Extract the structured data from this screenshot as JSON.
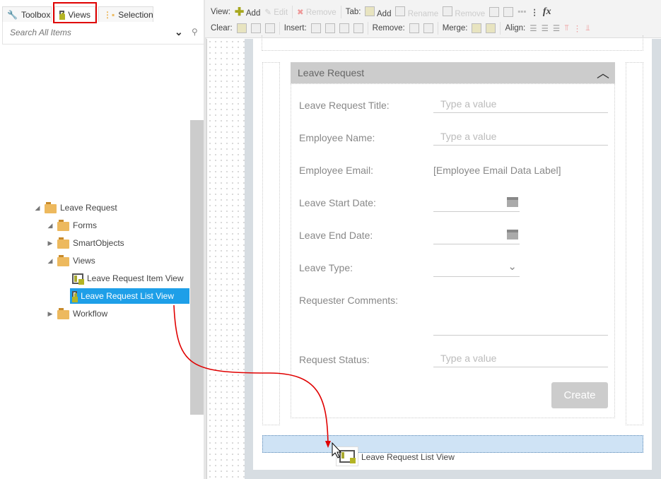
{
  "left_panel": {
    "tabs": [
      {
        "label": "Toolbox",
        "icon": "wrench-icon"
      },
      {
        "label": "Views",
        "icon": "view-icon"
      },
      {
        "label": "Selection",
        "icon": "tree-icon"
      }
    ],
    "search_placeholder": "Search All Items",
    "tree": {
      "root": "Leave Request",
      "children": [
        "Forms",
        "SmartObjects",
        "Views",
        "Workflow"
      ],
      "views": [
        "Leave Request Item View",
        "Leave Request List View"
      ],
      "selected": "Leave Request List View"
    }
  },
  "toolbar": {
    "view_label": "View:",
    "view_add": "Add",
    "view_edit": "Edit",
    "view_remove": "Remove",
    "tab_label": "Tab:",
    "tab_add": "Add",
    "tab_rename": "Rename",
    "tab_remove": "Remove",
    "fx": "fx",
    "clear_label": "Clear:",
    "insert_label": "Insert:",
    "remove_label": "Remove:",
    "merge_label": "Merge:",
    "align_label": "Align:"
  },
  "form": {
    "title": "Leave Request",
    "fields": [
      {
        "label": "Leave Request Title:",
        "placeholder": "Type a value"
      },
      {
        "label": "Employee Name:",
        "placeholder": "Type a value"
      },
      {
        "label": "Employee Email:",
        "value": "[Employee Email Data Label]"
      },
      {
        "label": "Leave Start Date:"
      },
      {
        "label": "Leave End Date:"
      },
      {
        "label": "Leave Type:"
      },
      {
        "label": "Requester Comments:"
      },
      {
        "label": "Request Status:",
        "placeholder": "Type a value"
      }
    ],
    "create_button": "Create"
  },
  "drag": {
    "label": "Leave Request List View"
  },
  "colors": {
    "selection": "#1e9fe8",
    "highlight": "#e00000",
    "drop_zone": "#cfe3f5"
  }
}
